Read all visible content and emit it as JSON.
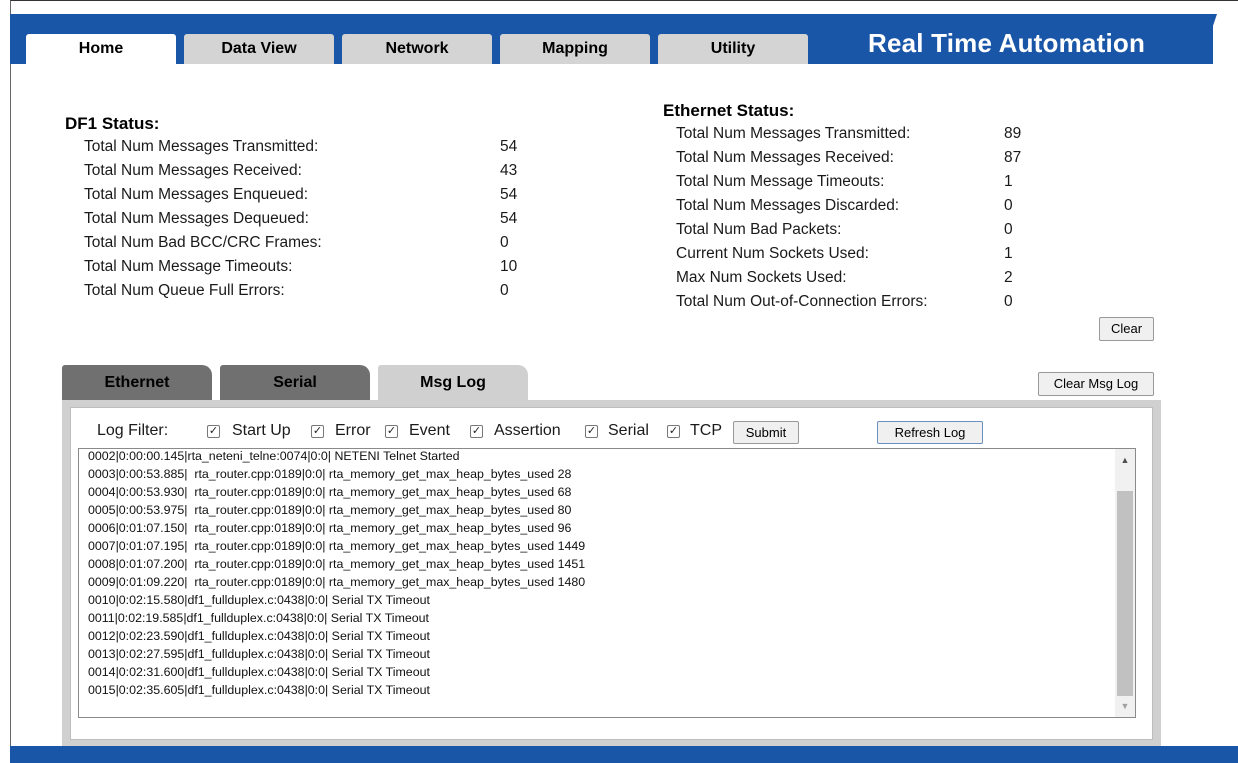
{
  "nav": {
    "tabs": [
      {
        "label": "Home"
      },
      {
        "label": "Data View"
      },
      {
        "label": "Network"
      },
      {
        "label": "Mapping"
      },
      {
        "label": "Utility"
      }
    ],
    "brand": "Real Time Automation"
  },
  "df1": {
    "title": "DF1 Status:",
    "rows": [
      {
        "label": "Total Num Messages Transmitted:",
        "value": "54"
      },
      {
        "label": "Total Num Messages Received:",
        "value": "43"
      },
      {
        "label": "Total Num Messages Enqueued:",
        "value": "54"
      },
      {
        "label": "Total Num Messages Dequeued:",
        "value": "54"
      },
      {
        "label": "Total Num Bad BCC/CRC Frames:",
        "value": "0"
      },
      {
        "label": "Total Num Message Timeouts:",
        "value": "10"
      },
      {
        "label": "Total Num Queue Full Errors:",
        "value": "0"
      }
    ]
  },
  "ethernet": {
    "title": "Ethernet Status:",
    "rows": [
      {
        "label": "Total Num Messages Transmitted:",
        "value": "89"
      },
      {
        "label": "Total Num Messages Received:",
        "value": "87"
      },
      {
        "label": "Total Num Message Timeouts:",
        "value": "1"
      },
      {
        "label": "Total Num Messages Discarded:",
        "value": "0"
      },
      {
        "label": "Total Num Bad Packets:",
        "value": "0"
      },
      {
        "label": "Current Num Sockets Used:",
        "value": "1"
      },
      {
        "label": "Max Num Sockets Used:",
        "value": "2"
      },
      {
        "label": "Total Num Out-of-Connection Errors:",
        "value": "0"
      }
    ],
    "clear_label": "Clear"
  },
  "lower_tabs": [
    {
      "label": "Ethernet"
    },
    {
      "label": "Serial"
    },
    {
      "label": "Msg Log"
    }
  ],
  "clear_msg_log_label": "Clear Msg Log",
  "log_filter": {
    "label": "Log Filter:",
    "options": [
      {
        "label": "Start Up",
        "checked": true
      },
      {
        "label": "Error",
        "checked": true
      },
      {
        "label": "Event",
        "checked": true
      },
      {
        "label": "Assertion",
        "checked": true
      },
      {
        "label": "Serial",
        "checked": true
      },
      {
        "label": "TCP",
        "checked": true
      }
    ],
    "submit_label": "Submit",
    "refresh_label": "Refresh Log"
  },
  "log_lines": [
    "0002|0:00:00.145|rta_neteni_telne:0074|0:0| NETENI Telnet Started",
    "0003|0:00:53.885|  rta_router.cpp:0189|0:0| rta_memory_get_max_heap_bytes_used 28",
    "0004|0:00:53.930|  rta_router.cpp:0189|0:0| rta_memory_get_max_heap_bytes_used 68",
    "0005|0:00:53.975|  rta_router.cpp:0189|0:0| rta_memory_get_max_heap_bytes_used 80",
    "0006|0:01:07.150|  rta_router.cpp:0189|0:0| rta_memory_get_max_heap_bytes_used 96",
    "0007|0:01:07.195|  rta_router.cpp:0189|0:0| rta_memory_get_max_heap_bytes_used 1449",
    "0008|0:01:07.200|  rta_router.cpp:0189|0:0| rta_memory_get_max_heap_bytes_used 1451",
    "0009|0:01:09.220|  rta_router.cpp:0189|0:0| rta_memory_get_max_heap_bytes_used 1480",
    "0010|0:02:15.580|df1_fullduplex.c:0438|0:0| Serial TX Timeout",
    "0011|0:02:19.585|df1_fullduplex.c:0438|0:0| Serial TX Timeout",
    "0012|0:02:23.590|df1_fullduplex.c:0438|0:0| Serial TX Timeout",
    "0013|0:02:27.595|df1_fullduplex.c:0438|0:0| Serial TX Timeout",
    "0014|0:02:31.600|df1_fullduplex.c:0438|0:0| Serial TX Timeout",
    "0015|0:02:35.605|df1_fullduplex.c:0438|0:0| Serial TX Timeout"
  ],
  "colors": {
    "brand_blue": "#1a56a8",
    "tab_gray": "#d4d4d4",
    "lower_tab_gray": "#707070",
    "panel_gray": "#d0d0d0"
  }
}
